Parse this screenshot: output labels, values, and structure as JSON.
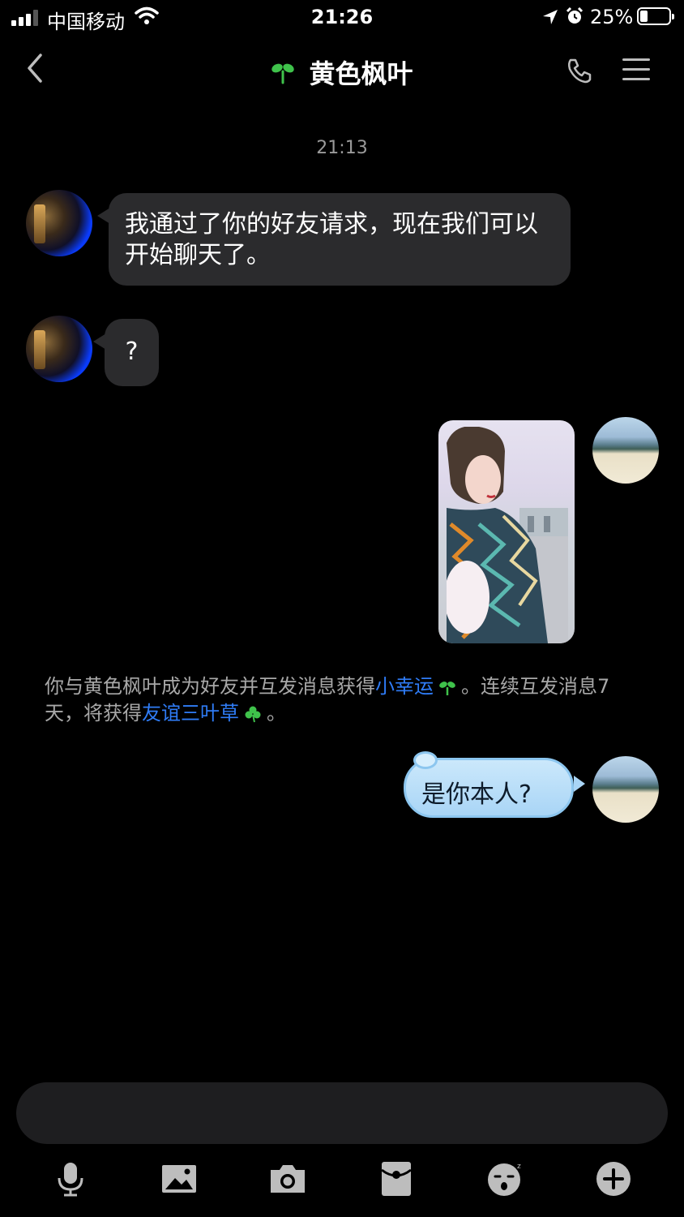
{
  "status_bar": {
    "carrier": "中国移动",
    "time": "21:26",
    "battery_percent": "25%",
    "battery_level": 0.25,
    "icons": [
      "signal-icon",
      "wifi-icon",
      "location-icon",
      "alarm-icon",
      "battery-icon"
    ]
  },
  "header": {
    "title": "黄色枫叶",
    "icons": [
      "back-icon",
      "sprout-icon",
      "phone-icon",
      "menu-icon"
    ]
  },
  "chat": {
    "timestamp": "21:13",
    "messages": [
      {
        "sender": "them",
        "type": "text",
        "text": "我通过了你的好友请求，现在我们可以开始聊天了。"
      },
      {
        "sender": "them",
        "type": "text",
        "text": "?"
      },
      {
        "sender": "me",
        "type": "image"
      },
      {
        "sender": "me",
        "type": "text",
        "text": "是你本人?"
      }
    ],
    "system_note": {
      "part1": "你与黄色枫叶成为好友并互发消息获得",
      "link1": "小幸运",
      "part2": "。连续互发消息7天，将获得",
      "link2": "友谊三叶草",
      "part3": "。"
    }
  },
  "toolbar": {
    "icons": [
      "microphone-icon",
      "image-icon",
      "camera-icon",
      "red-packet-icon",
      "emoji-icon",
      "plus-icon"
    ]
  },
  "colors": {
    "background": "#000000",
    "bubble_them": "#2b2b2d",
    "bubble_me": "#a9d5f6",
    "link": "#2f7cf6",
    "muted_text": "#a8a8a8"
  }
}
